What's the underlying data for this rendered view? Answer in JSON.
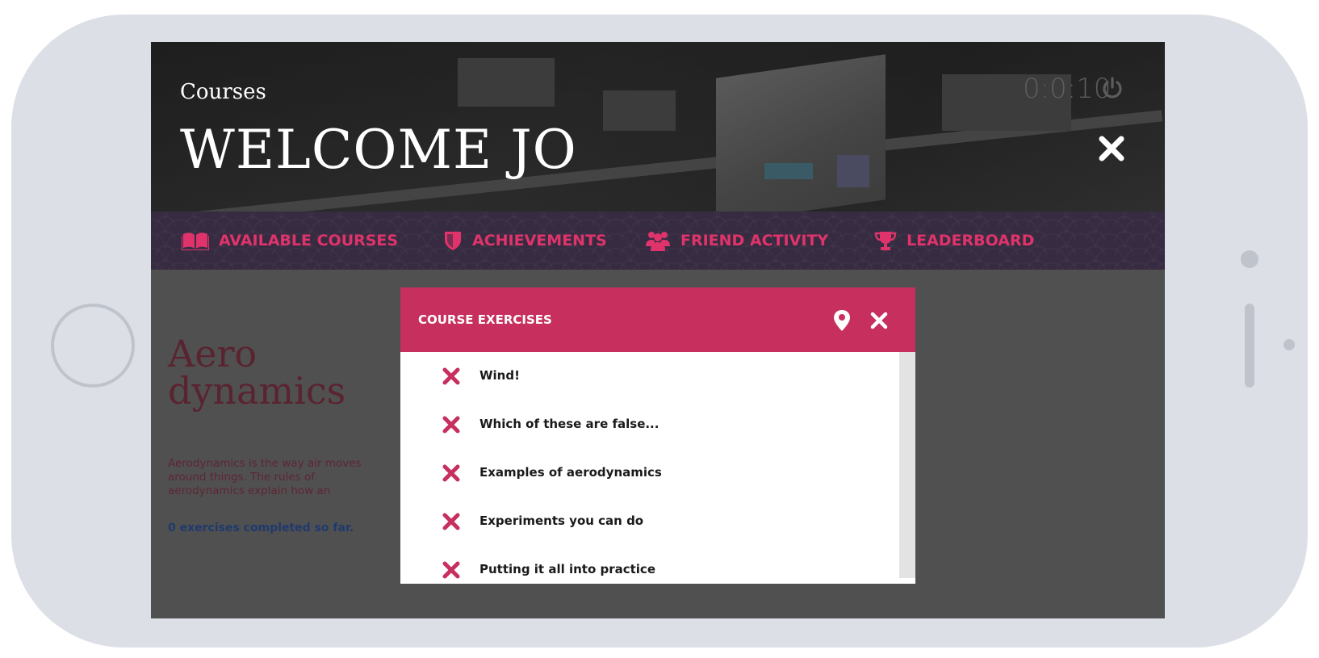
{
  "header": {
    "section_label": "Courses",
    "welcome": "WELCOME JO",
    "timer": "0:0:10"
  },
  "nav": {
    "items": [
      {
        "label": "AVAILABLE COURSES",
        "icon": "book-icon"
      },
      {
        "label": "ACHIEVEMENTS",
        "icon": "shield-icon"
      },
      {
        "label": "FRIEND ACTIVITY",
        "icon": "users-icon"
      },
      {
        "label": "LEADERBOARD",
        "icon": "trophy-icon"
      }
    ]
  },
  "course": {
    "title_line1": "Aero",
    "title_line2": "dynamics",
    "description": "Aerodynamics is the way air moves around things. The rules of aerodynamics explain how an",
    "progress": "0 exercises completed so far."
  },
  "modal": {
    "title": "COURSE EXERCISES",
    "exercises": [
      {
        "label": "Wind!",
        "status": "incomplete"
      },
      {
        "label": "Which of these are false...",
        "status": "incomplete"
      },
      {
        "label": "Examples of aerodynamics",
        "status": "incomplete"
      },
      {
        "label": "Experiments you can do",
        "status": "incomplete"
      },
      {
        "label": "Putting it all into practice",
        "status": "incomplete"
      }
    ]
  },
  "colors": {
    "accent": "#c62f5e",
    "nav_text": "#e0336b",
    "nav_bg": "#362b40",
    "phone_frame": "#dcdfe6",
    "screen_bg": "#505050"
  }
}
